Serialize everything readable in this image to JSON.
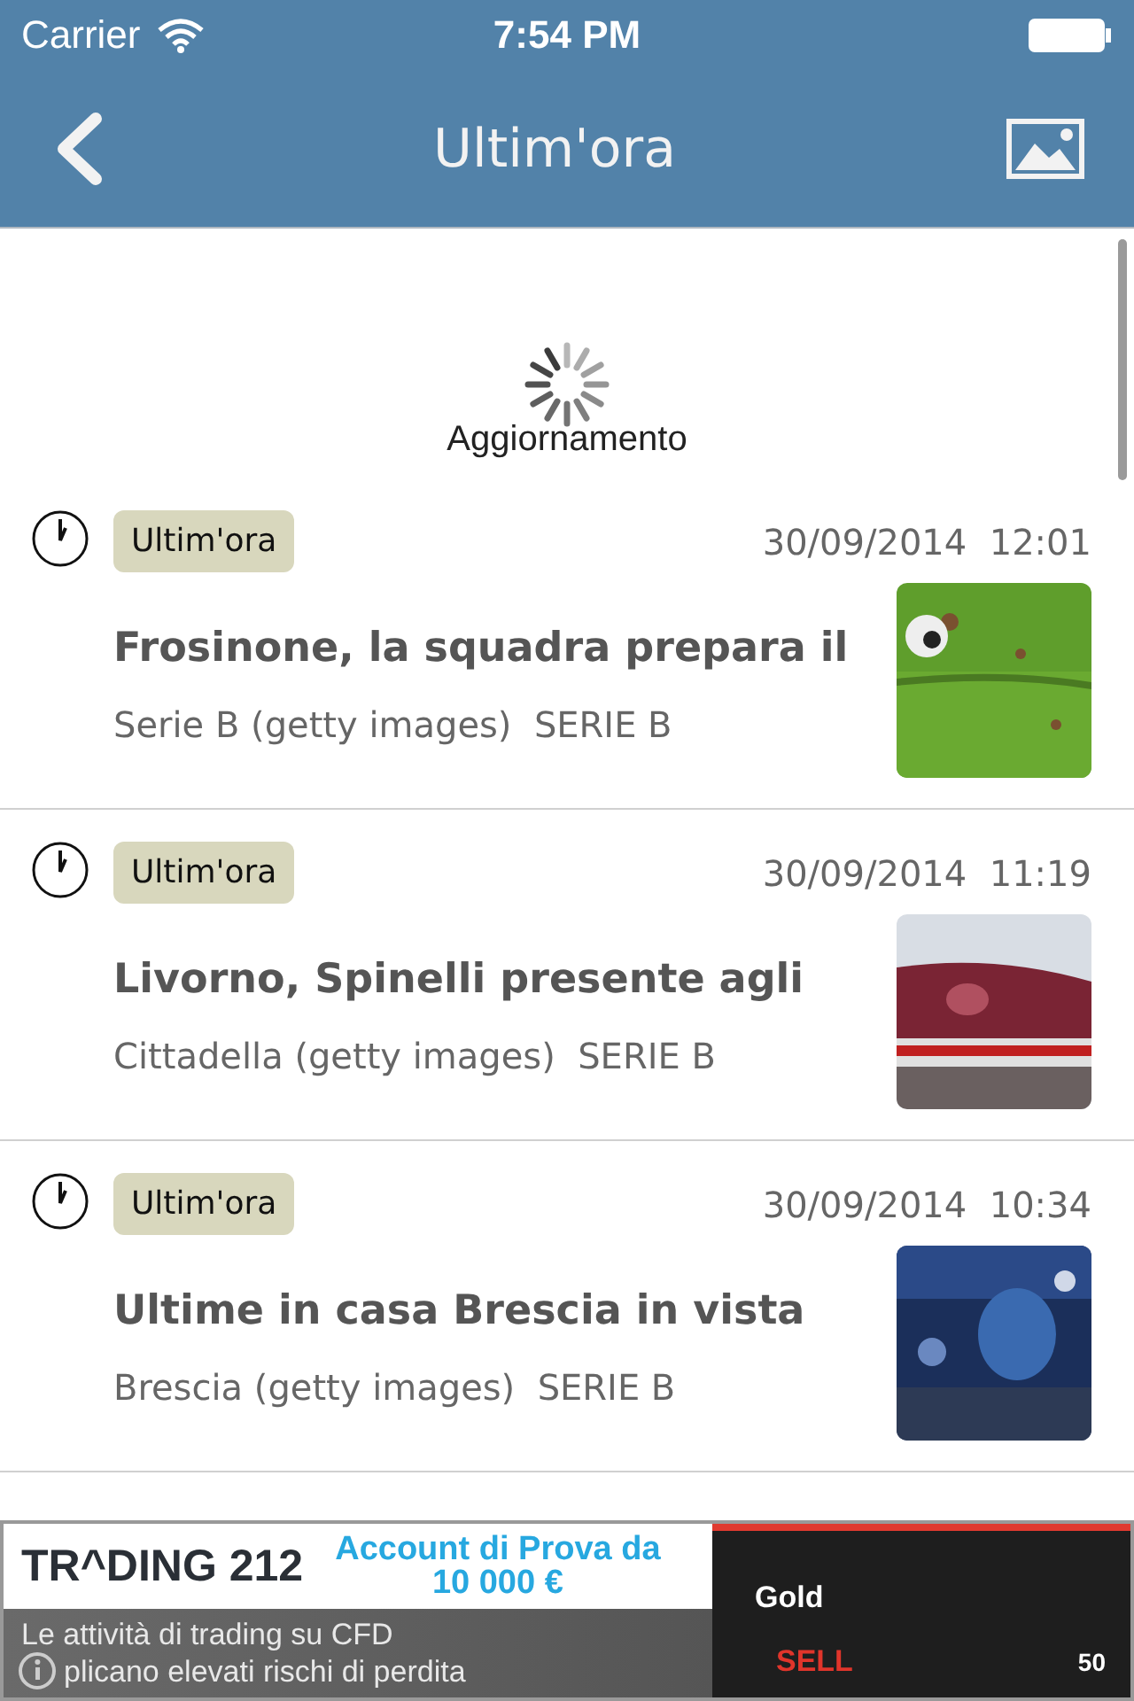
{
  "status_bar": {
    "carrier": "Carrier",
    "time": "7:54 PM"
  },
  "nav": {
    "title": "Ultim'ora"
  },
  "refresh": {
    "label": "Aggiornamento"
  },
  "news": [
    {
      "tag": "Ultim'ora",
      "date": "30/09/2014",
      "time": "12:01",
      "headline": "Frosinone, la squadra prepara il",
      "source": "Serie B (getty images)",
      "category": "SERIE B"
    },
    {
      "tag": "Ultim'ora",
      "date": "30/09/2014",
      "time": "11:19",
      "headline": "Livorno, Spinelli presente agli",
      "source": "Cittadella (getty images)",
      "category": "SERIE B"
    },
    {
      "tag": "Ultim'ora",
      "date": "30/09/2014",
      "time": "10:34",
      "headline": "Ultime in casa Brescia in vista",
      "source": "Brescia (getty images)",
      "category": "SERIE B"
    }
  ],
  "ad": {
    "brand": "TR^DING 212",
    "offer_line_1": "Account di Prova da",
    "offer_line_2": "10 000 €",
    "warning_line_1": "Le attività di trading su CFD",
    "warning_line_2": "plicano elevati rischi di perdita",
    "panel_label": "Gold",
    "panel_action": "SELL",
    "panel_value": "50"
  }
}
